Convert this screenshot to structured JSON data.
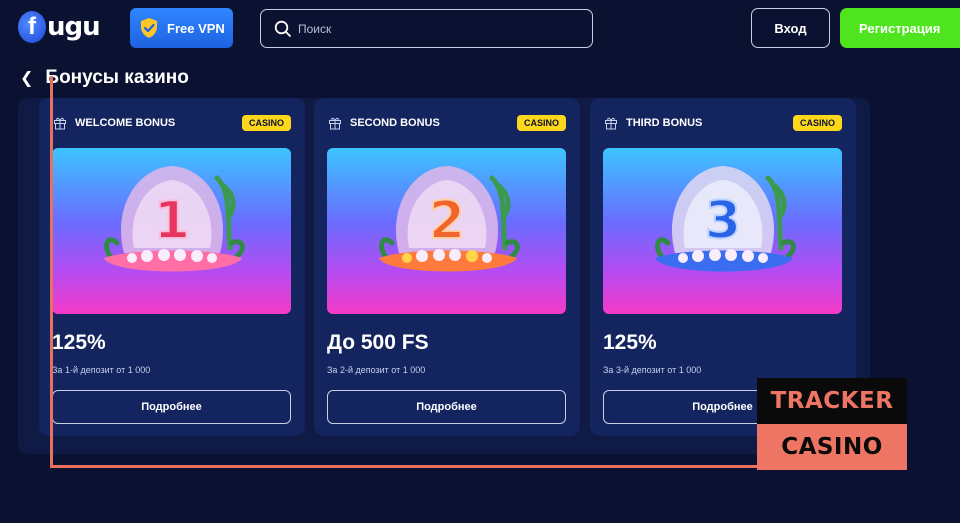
{
  "header": {
    "logo_text": "ugu",
    "logo_letter": "f",
    "vpn_label": "Free VPN",
    "search_placeholder": "Поиск",
    "login_label": "Вход",
    "register_label": "Регистрация"
  },
  "page": {
    "title": "Бонусы казино"
  },
  "cards": [
    {
      "name": "WELCOME BONUS",
      "badge": "CASINO",
      "number": "1",
      "amount": "125%",
      "subtitle": "За 1-й депозит от 1 000",
      "button": "Подробнее",
      "number_color": "#e8355f"
    },
    {
      "name": "SECOND BONUS",
      "badge": "CASINO",
      "number": "2",
      "amount": "До 500 FS",
      "subtitle": "За 2-й депозит от 1 000",
      "button": "Подробнее",
      "number_color": "#f0652b"
    },
    {
      "name": "THIRD BONUS",
      "badge": "CASINO",
      "number": "3",
      "amount": "125%",
      "subtitle": "За 3-й депозит от 1 000",
      "button": "Подробнее",
      "number_color": "#2a63e6"
    }
  ],
  "watermark": {
    "line1": "TRACKER",
    "line2": "CASINO"
  },
  "colors": {
    "background": "#0b1130",
    "card": "#13245e",
    "accent_green": "#4ee41e",
    "accent_blue": "#2f86ff",
    "badge_yellow": "#ffd71a",
    "watermark_coral": "#ee7563"
  }
}
